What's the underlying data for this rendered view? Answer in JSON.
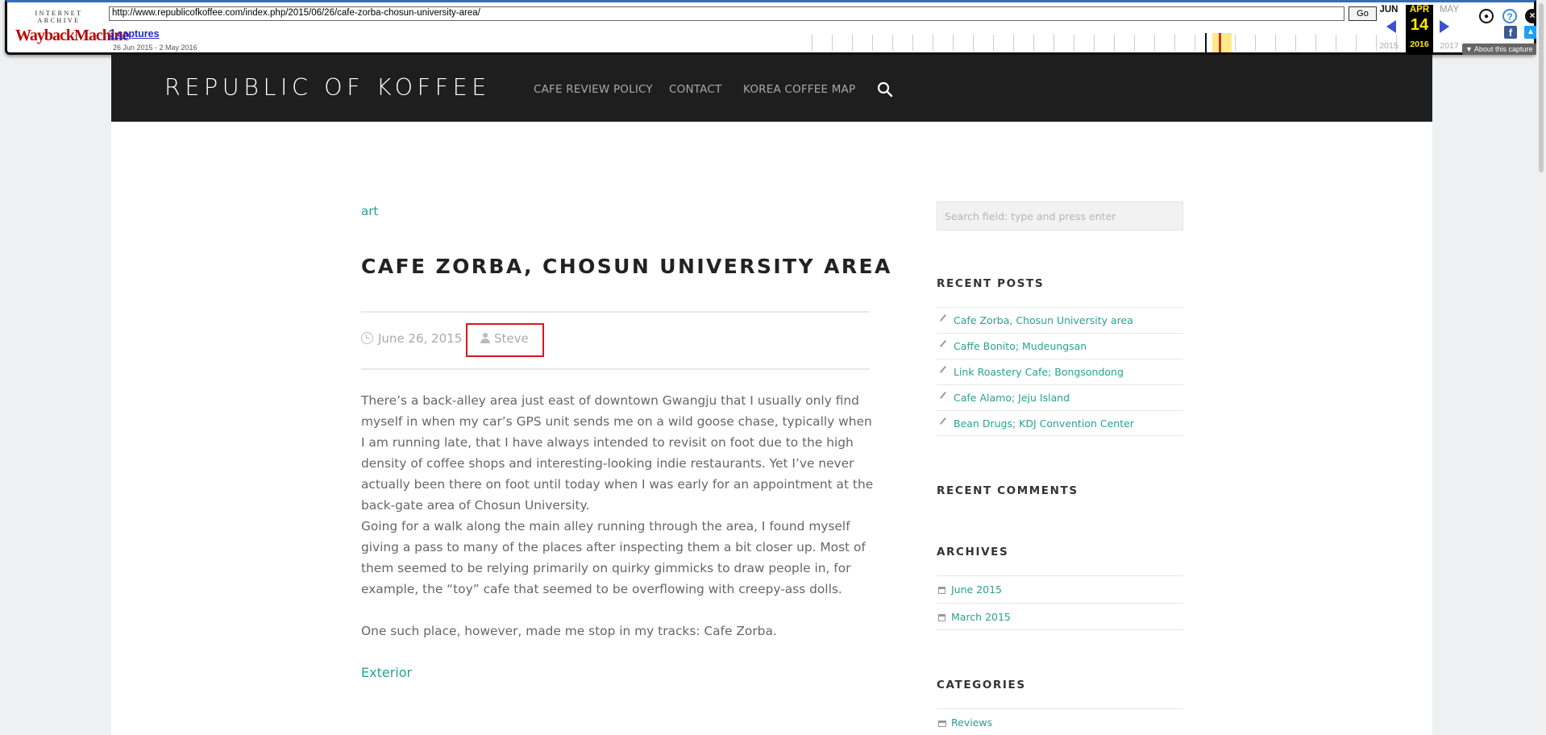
{
  "wayback": {
    "logo_top": "INTERNET ARCHIVE",
    "logo_main": "WaybackMachine",
    "url": "http://www.republicofkoffee.com/index.php/2015/06/26/cafe-zorba-chosun-university-area/",
    "go_label": "Go",
    "captures": "3 captures",
    "range": "26 Jun 2015 - 2 May 2016",
    "prev_month": "JUN",
    "cur_month": "APR",
    "next_month": "MAY",
    "day": "14",
    "prev_year": "2015",
    "cur_year": "2016",
    "next_year": "2017",
    "about": "About this capture",
    "icons": [
      "user-icon",
      "help-icon",
      "close-icon",
      "facebook-icon",
      "twitter-icon"
    ]
  },
  "site": {
    "title": "REPUBLIC OF KOFFEE",
    "nav": [
      "CAFE REVIEW POLICY",
      "CONTACT",
      "KOREA COFFEE MAP"
    ]
  },
  "post": {
    "category": "art",
    "title": "CAFE ZORBA, CHOSUN UNIVERSITY AREA",
    "date": "June 26, 2015",
    "author": "Steve",
    "paragraphs": [
      "There’s a back-alley area just east of downtown Gwangju that I usually only find myself in when my car’s GPS unit sends me on a wild goose chase, typically when I am running late, that I have always intended to revisit on foot due to the high density of coffee shops and interesting-looking indie restaurants. Yet I’ve never actually been there on foot until today when I was early for an appointment at the back-gate area of Chosun University.",
      "Going for a walk along the main alley running through the area, I found myself giving a pass to many of the places after inspecting them a bit closer up. Most of them seemed to be relying primarily on quirky gimmicks to draw people in, for example, the “toy” cafe that seemed to be overflowing with creepy-ass dolls.",
      "One such place, however, made me stop in my tracks: Cafe Zorba."
    ],
    "exterior_link": "Exterior"
  },
  "sidebar": {
    "search_placeholder": "Search field: type and press enter",
    "recent_posts_title": "RECENT POSTS",
    "recent_posts": [
      "Cafe Zorba, Chosun University area",
      "Caffe Bonito; Mudeungsan",
      "Link Roastery Cafe; Bongsondong",
      "Cafe Alamo; Jeju Island",
      "Bean Drugs; KDJ Convention Center"
    ],
    "recent_comments_title": "RECENT COMMENTS",
    "archives_title": "ARCHIVES",
    "archives": [
      "June 2015",
      "March 2015"
    ],
    "categories_title": "CATEGORIES",
    "categories": [
      "Reviews"
    ]
  },
  "colors": {
    "accent": "#26a38e",
    "header_bg": "#1e1e1e",
    "highlight_box": "#d9181c"
  }
}
